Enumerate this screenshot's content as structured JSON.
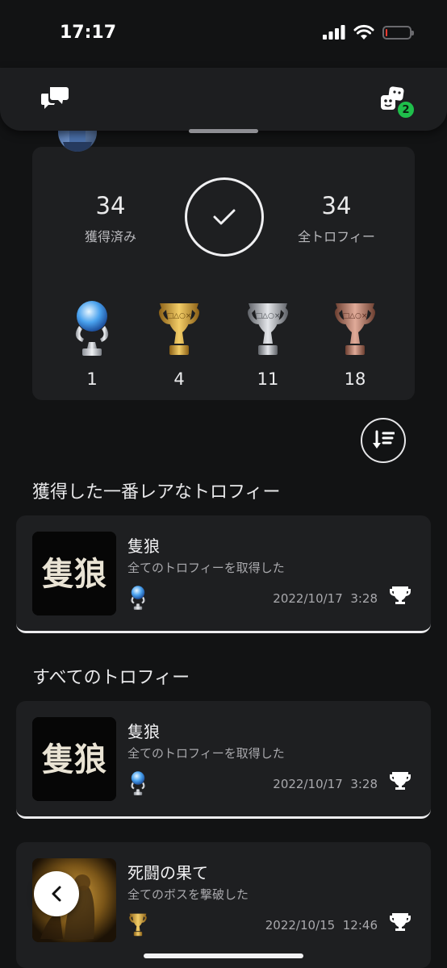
{
  "status_bar": {
    "time": "17:17"
  },
  "header": {
    "party_badge_count": "2"
  },
  "summary": {
    "earned_count": "34",
    "earned_label": "獲得済み",
    "total_count": "34",
    "total_label": "全トロフィー",
    "tiers": [
      {
        "name": "platinum",
        "count": "1"
      },
      {
        "name": "gold",
        "count": "4"
      },
      {
        "name": "silver",
        "count": "11"
      },
      {
        "name": "bronze",
        "count": "18"
      }
    ]
  },
  "sections": {
    "rarest_title": "獲得した一番レアなトロフィー",
    "all_title": "すべてのトロフィー"
  },
  "rarest": {
    "title": "隻狼",
    "description": "全てのトロフィーを取得した",
    "tier": "platinum",
    "date": "2022/10/17",
    "time": "3:28"
  },
  "trophies": [
    {
      "title": "隻狼",
      "description": "全てのトロフィーを取得した",
      "tier": "platinum",
      "date": "2022/10/17",
      "time": "3:28"
    },
    {
      "title": "死闘の果て",
      "description": "全てのボスを撃破した",
      "tier": "gold",
      "date": "2022/10/15",
      "time": "12:46"
    }
  ],
  "art": {
    "game_logo_text": "隻狼"
  },
  "colors": {
    "background": "#121314",
    "card": "#1e1f21",
    "badge_green": "#1fbf4b",
    "battery_red": "#ff3b30",
    "platinum": "#9fd0ff",
    "gold": "#d6a63a",
    "silver": "#b5b8bd",
    "bronze": "#c28a78"
  },
  "icons": [
    "cellular-signal-icon",
    "wifi-icon",
    "battery-icon",
    "chat-icon",
    "party-icon",
    "checkmark-icon",
    "sort-icon",
    "trophy-outline-icon",
    "back-chevron-icon"
  ]
}
